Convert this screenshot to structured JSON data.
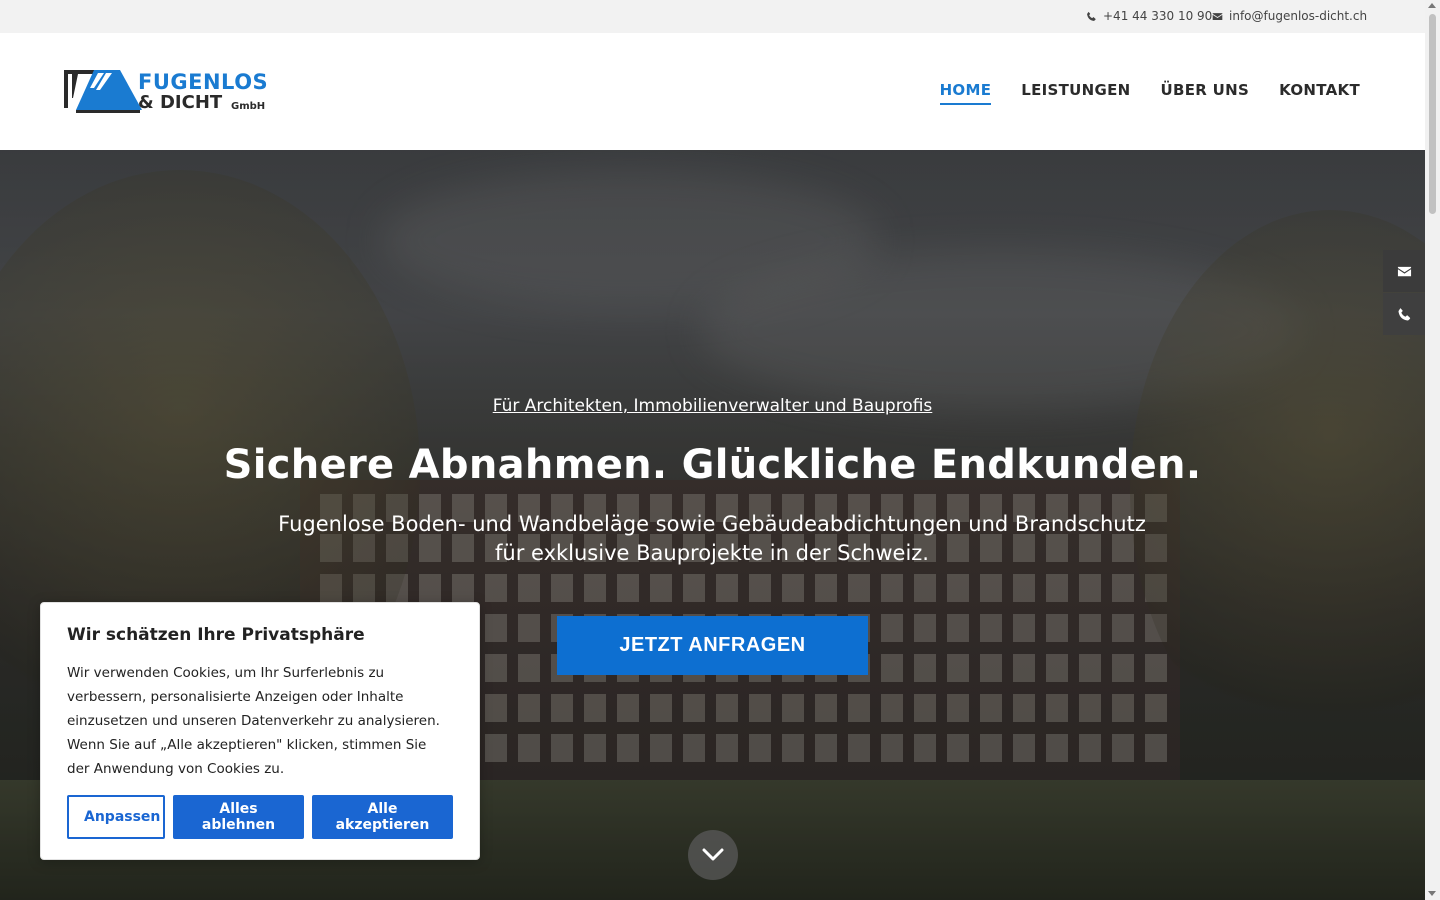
{
  "topbar": {
    "phone": "+41 44 330 10 90",
    "email": "info@fugenlos-dicht.ch",
    "phone_icon": "phone-icon",
    "email_icon": "envelope-icon"
  },
  "header": {
    "logo": {
      "line1": "FUGENLOS",
      "line2": "& DICHT",
      "suffix": "GmbH"
    },
    "nav": [
      {
        "label": "HOME",
        "active": true
      },
      {
        "label": "LEISTUNGEN",
        "active": false
      },
      {
        "label": "ÜBER UNS",
        "active": false
      },
      {
        "label": "KONTAKT",
        "active": false
      }
    ]
  },
  "hero": {
    "kicker": "Für Architekten, Immobilienverwalter und Bauprofis",
    "title": "Sichere Abnahmen. Glückliche Endkunden.",
    "subtitle": "Fugenlose Boden- und Wandbeläge sowie Gebäudeabdichtungen und Brandschutz für exklusive Bauprojekte in der Schweiz.",
    "cta": "JETZT ANFRAGEN",
    "scroll_icon": "chevron-down-icon"
  },
  "side_contact": {
    "mail_icon": "envelope-icon",
    "phone_icon": "phone-icon"
  },
  "cookie": {
    "title": "Wir schätzen Ihre Privatsphäre",
    "text": "Wir verwenden Cookies, um Ihr Surferlebnis zu verbessern, personalisierte Anzeigen oder Inhalte einzusetzen und unseren Datenverkehr zu analysieren. Wenn Sie auf „Alle akzeptieren\" klicken, stimmen Sie der Anwendung von Cookies zu.",
    "btn_customize": "Anpassen",
    "btn_reject": "Alles ablehnen",
    "btn_accept": "Alle akzeptieren"
  },
  "colors": {
    "brand_blue": "#1a7bd1",
    "cta_blue": "#0d6fd1",
    "cookie_blue": "#1a66d2"
  }
}
